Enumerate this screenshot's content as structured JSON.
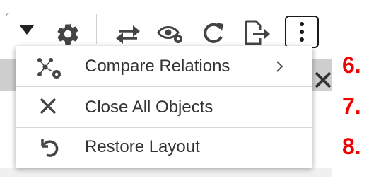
{
  "toolbar": {
    "icons": [
      "chevron-down-icon",
      "gear-icon",
      "swap-arrows-icon",
      "eye-settings-icon",
      "refresh-icon",
      "export-icon",
      "more-vertical-icon"
    ]
  },
  "menu": {
    "items": [
      {
        "label": "Compare Relations",
        "icon": "network-compare-icon",
        "has_submenu": true
      },
      {
        "label": "Close All Objects",
        "icon": "close-icon",
        "has_submenu": false
      },
      {
        "label": "Restore Layout",
        "icon": "restore-icon",
        "has_submenu": false
      }
    ]
  },
  "steps": [
    "6.",
    "7.",
    "8."
  ],
  "colors": {
    "step_number": "#ee0000",
    "icon": "#3a3a3a",
    "menu_text": "#333333"
  }
}
